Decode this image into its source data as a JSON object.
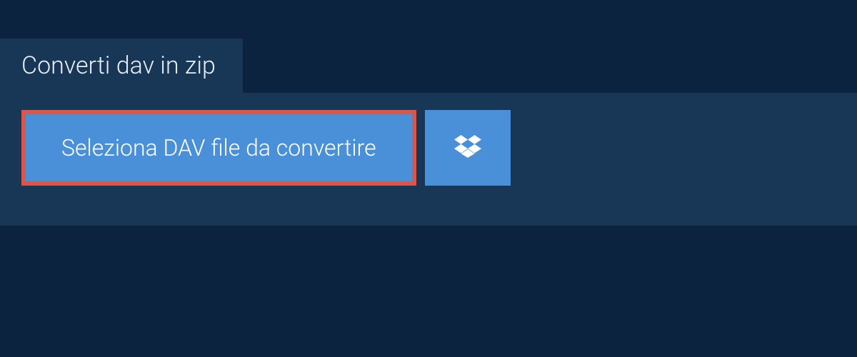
{
  "tab": {
    "title": "Converti dav in zip"
  },
  "actions": {
    "select_label": "Seleziona DAV file da convertire"
  },
  "colors": {
    "bg_dark": "#0c2340",
    "panel": "#183655",
    "button": "#4a90d9",
    "highlight_border": "#d5574e",
    "text_light": "#ffffff"
  }
}
